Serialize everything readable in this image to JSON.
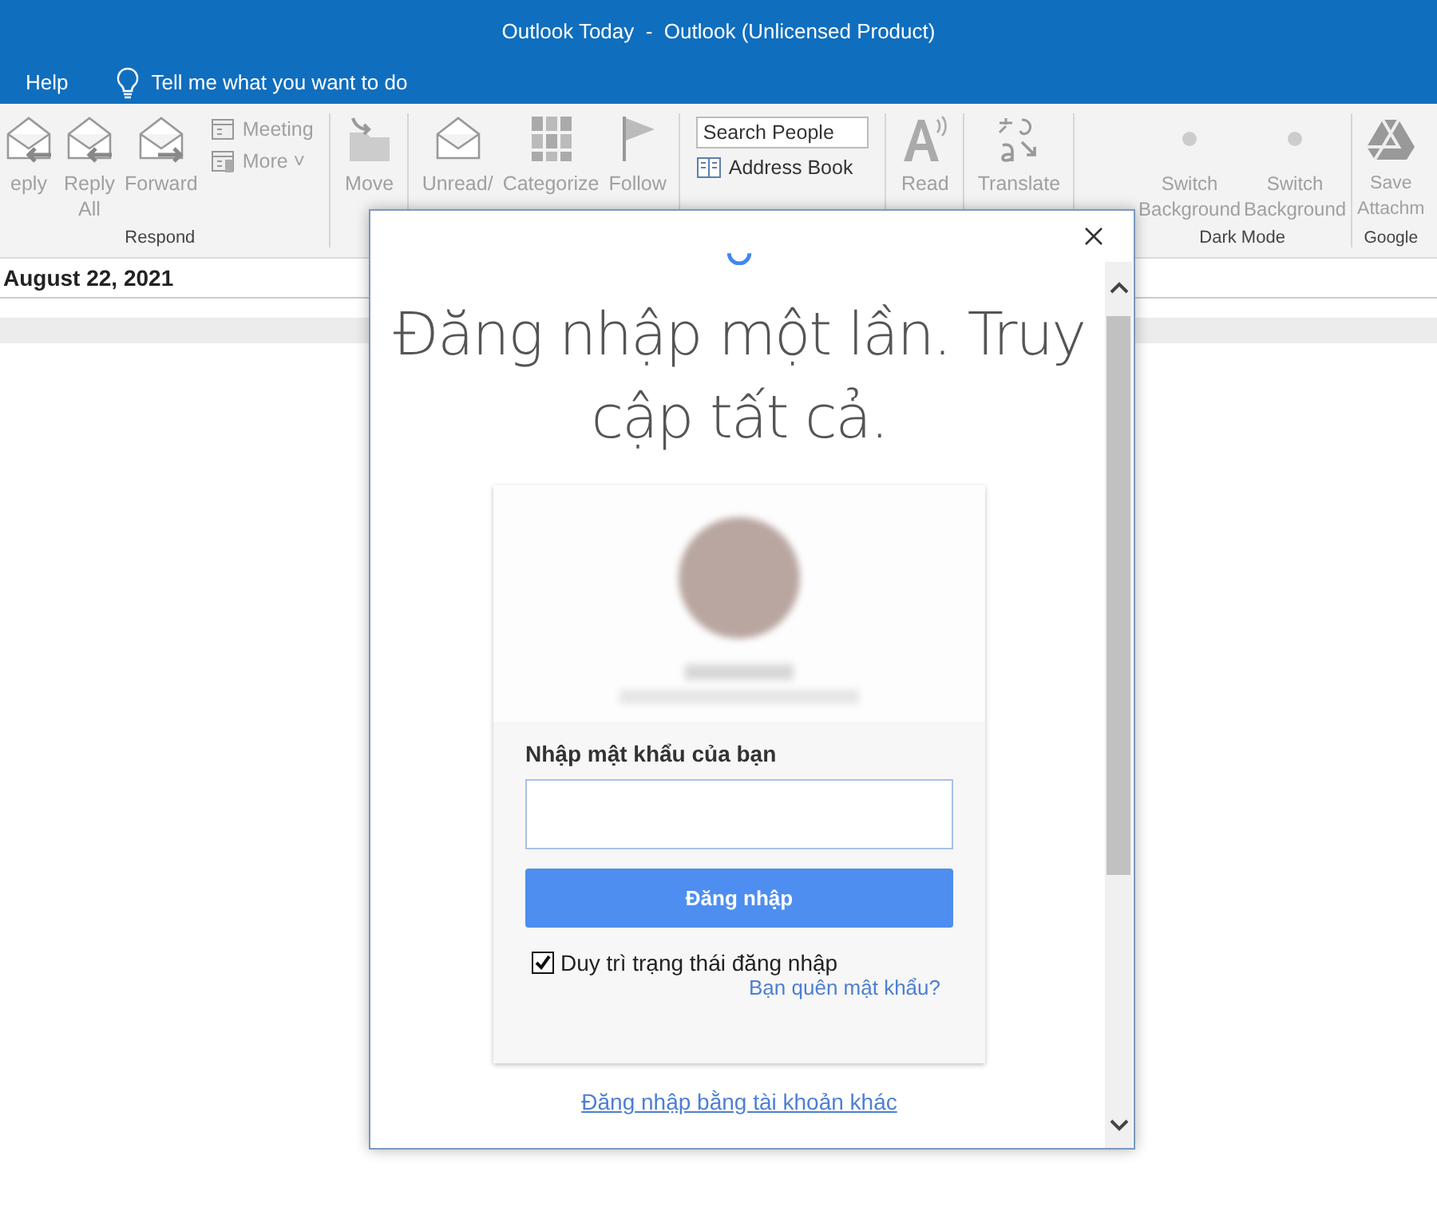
{
  "window": {
    "title": "Outlook Today  -  Outlook (Unlicensed Product)"
  },
  "menu": {
    "items": [
      {
        "label": "Help"
      }
    ],
    "tell_me": "Tell me what you want to do"
  },
  "ribbon": {
    "groups": [
      {
        "label": "Respond",
        "items": [
          {
            "kind": "large",
            "lines": [
              "eply"
            ]
          },
          {
            "kind": "large",
            "lines": [
              "Reply",
              "All"
            ]
          },
          {
            "kind": "large",
            "lines": [
              "Forward"
            ]
          },
          {
            "kind": "stack",
            "entries": [
              {
                "label": "Meeting"
              },
              {
                "label": "More ˅"
              }
            ]
          }
        ]
      },
      {
        "items": [
          {
            "kind": "large",
            "lines": [
              "Move"
            ]
          }
        ]
      },
      {
        "items": [
          {
            "kind": "large",
            "lines": [
              "Unread/"
            ]
          },
          {
            "kind": "large",
            "lines": [
              "Categorize"
            ]
          },
          {
            "kind": "large",
            "lines": [
              "Follow"
            ]
          }
        ]
      },
      {
        "items": [
          {
            "kind": "search",
            "placeholder": "Search People",
            "entries": [
              {
                "label": "Address Book"
              }
            ]
          }
        ]
      },
      {
        "items": [
          {
            "kind": "large",
            "lines": [
              "Read"
            ]
          }
        ]
      },
      {
        "items": [
          {
            "kind": "large",
            "lines": [
              "Translate"
            ]
          }
        ]
      },
      {
        "label": "Dark Mode",
        "items": [
          {
            "kind": "large",
            "lines": [
              "Switch",
              "Background"
            ]
          },
          {
            "kind": "large",
            "lines": [
              "Switch",
              "Background"
            ]
          }
        ]
      },
      {
        "label": "Google",
        "items": [
          {
            "kind": "large",
            "lines": [
              "Save",
              "Attachm"
            ]
          }
        ]
      }
    ]
  },
  "date": "August 22, 2021",
  "dialog": {
    "heading": "Đăng nhập một lần. Truy cập tất cả.",
    "password_label": "Nhập mật khẩu của bạn",
    "submit": "Đăng nhập",
    "remember": {
      "label": "Duy trì trạng thái đăng nhập",
      "checked": true
    },
    "forgot": "Bạn quên mật khẩu?",
    "other_account": "Đăng nhập bằng tài khoản khác"
  }
}
